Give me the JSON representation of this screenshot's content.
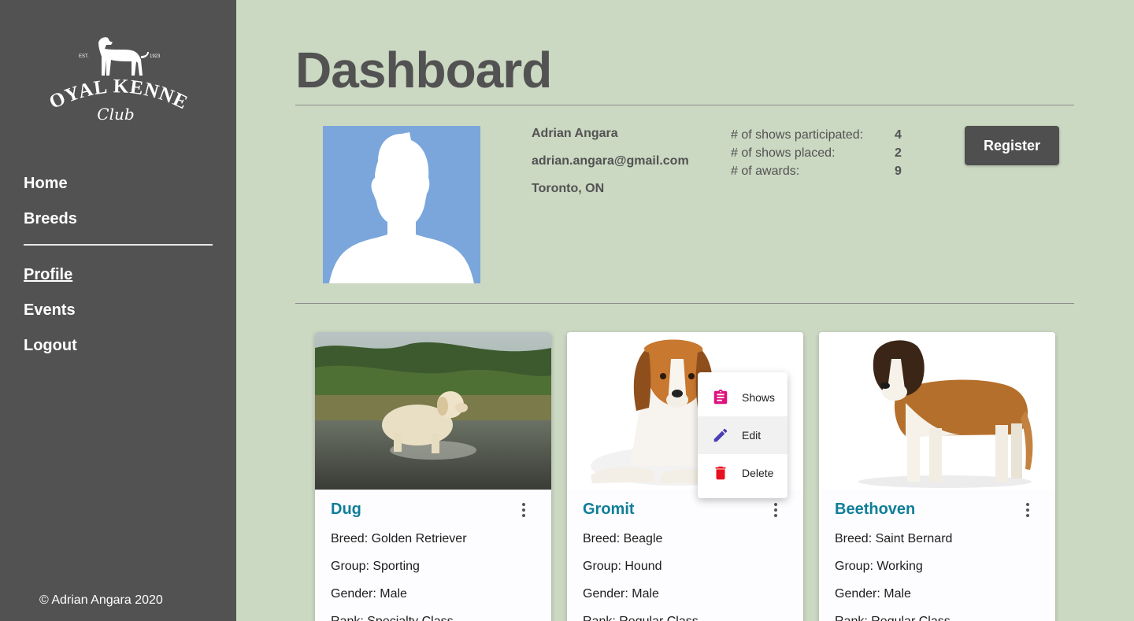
{
  "sidebar": {
    "logo": {
      "est": "EST.",
      "year": "1923",
      "line1": "ROYAL KENNEL",
      "line2": "Club"
    },
    "nav_primary": [
      {
        "label": "Home"
      },
      {
        "label": "Breeds"
      }
    ],
    "nav_secondary": [
      {
        "label": "Profile",
        "active": true
      },
      {
        "label": "Events"
      },
      {
        "label": "Logout"
      }
    ],
    "copyright": "© Adrian Angara 2020"
  },
  "header": {
    "title": "Dashboard"
  },
  "profile": {
    "name": "Adrian Angara",
    "email": "adrian.angara@gmail.com",
    "location": "Toronto, ON",
    "stats": [
      {
        "label": "# of shows participated:",
        "value": "4"
      },
      {
        "label": "# of shows placed:",
        "value": "2"
      },
      {
        "label": "# of awards:",
        "value": "9"
      }
    ],
    "register_label": "Register"
  },
  "dogs": [
    {
      "name": "Dug",
      "breed": "Breed: Golden Retriever",
      "group": "Group: Sporting",
      "gender": "Gender: Male",
      "rank": "Rank: Specialty Class"
    },
    {
      "name": "Gromit",
      "breed": "Breed: Beagle",
      "group": "Group: Hound",
      "gender": "Gender: Male",
      "rank": "Rank: Regular Class"
    },
    {
      "name": "Beethoven",
      "breed": "Breed: Saint Bernard",
      "group": "Group: Working",
      "gender": "Gender: Male",
      "rank": "Rank: Regular Class"
    }
  ],
  "context_menu": {
    "items": [
      {
        "label": "Shows",
        "icon": "clipboard-icon",
        "color": "#e0127e"
      },
      {
        "label": "Edit",
        "icon": "pencil-icon",
        "color": "#4b3fb5"
      },
      {
        "label": "Delete",
        "icon": "trash-icon",
        "color": "#e8101e"
      }
    ]
  }
}
